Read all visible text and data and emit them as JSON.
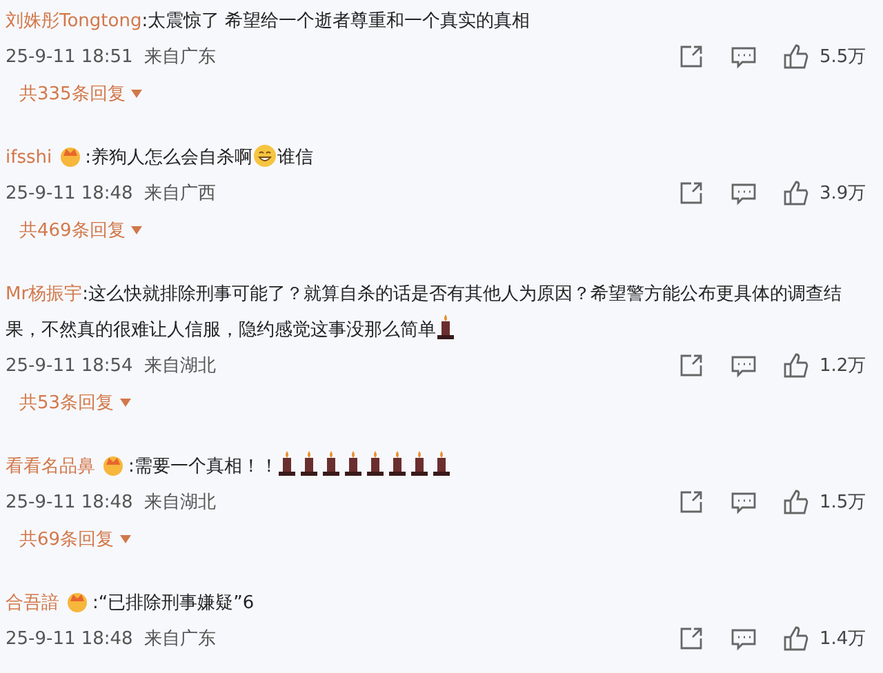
{
  "comments": [
    {
      "user": "刘姝彤Tongtong",
      "badge": false,
      "parts": [
        {
          "kind": "text",
          "text": ":太震惊了 希望给一个逝者尊重和一个真实的真相"
        }
      ],
      "time": "25-9-11 18:51",
      "location": "来自广东",
      "likes": "5.5万",
      "replies": "共335条回复"
    },
    {
      "user": "ifsshi",
      "badge": true,
      "parts": [
        {
          "kind": "text",
          "text": ":养狗人怎么会自杀啊"
        },
        {
          "kind": "face"
        },
        {
          "kind": "text",
          "text": "谁信"
        }
      ],
      "time": "25-9-11 18:48",
      "location": "来自广西",
      "likes": "3.9万",
      "replies": "共469条回复"
    },
    {
      "user": "Mr杨振宇",
      "badge": false,
      "parts": [
        {
          "kind": "text",
          "text": ":这么快就排除刑事可能了？就算自杀的话是否有其他人为原因？希望警方能公布更具体的调查结果，不然真的很难让人信服，隐约感觉这事没那么简单"
        },
        {
          "kind": "candle"
        }
      ],
      "time": "25-9-11 18:54",
      "location": "来自湖北",
      "likes": "1.2万",
      "replies": "共53条回复"
    },
    {
      "user": "看看名品鼻",
      "badge": true,
      "parts": [
        {
          "kind": "text",
          "text": ":需要一个真相！！"
        },
        {
          "kind": "candle"
        },
        {
          "kind": "candle"
        },
        {
          "kind": "candle"
        },
        {
          "kind": "candle"
        },
        {
          "kind": "candle"
        },
        {
          "kind": "candle"
        },
        {
          "kind": "candle"
        },
        {
          "kind": "candle"
        }
      ],
      "time": "25-9-11 18:48",
      "location": "来自湖北",
      "likes": "1.5万",
      "replies": "共69条回复"
    },
    {
      "user": "合吾諳",
      "badge": true,
      "parts": [
        {
          "kind": "text",
          "text": ":“已排除刑事嫌疑”6"
        }
      ],
      "time": "25-9-11 18:48",
      "location": "来自广东",
      "likes": "1.4万"
    }
  ]
}
